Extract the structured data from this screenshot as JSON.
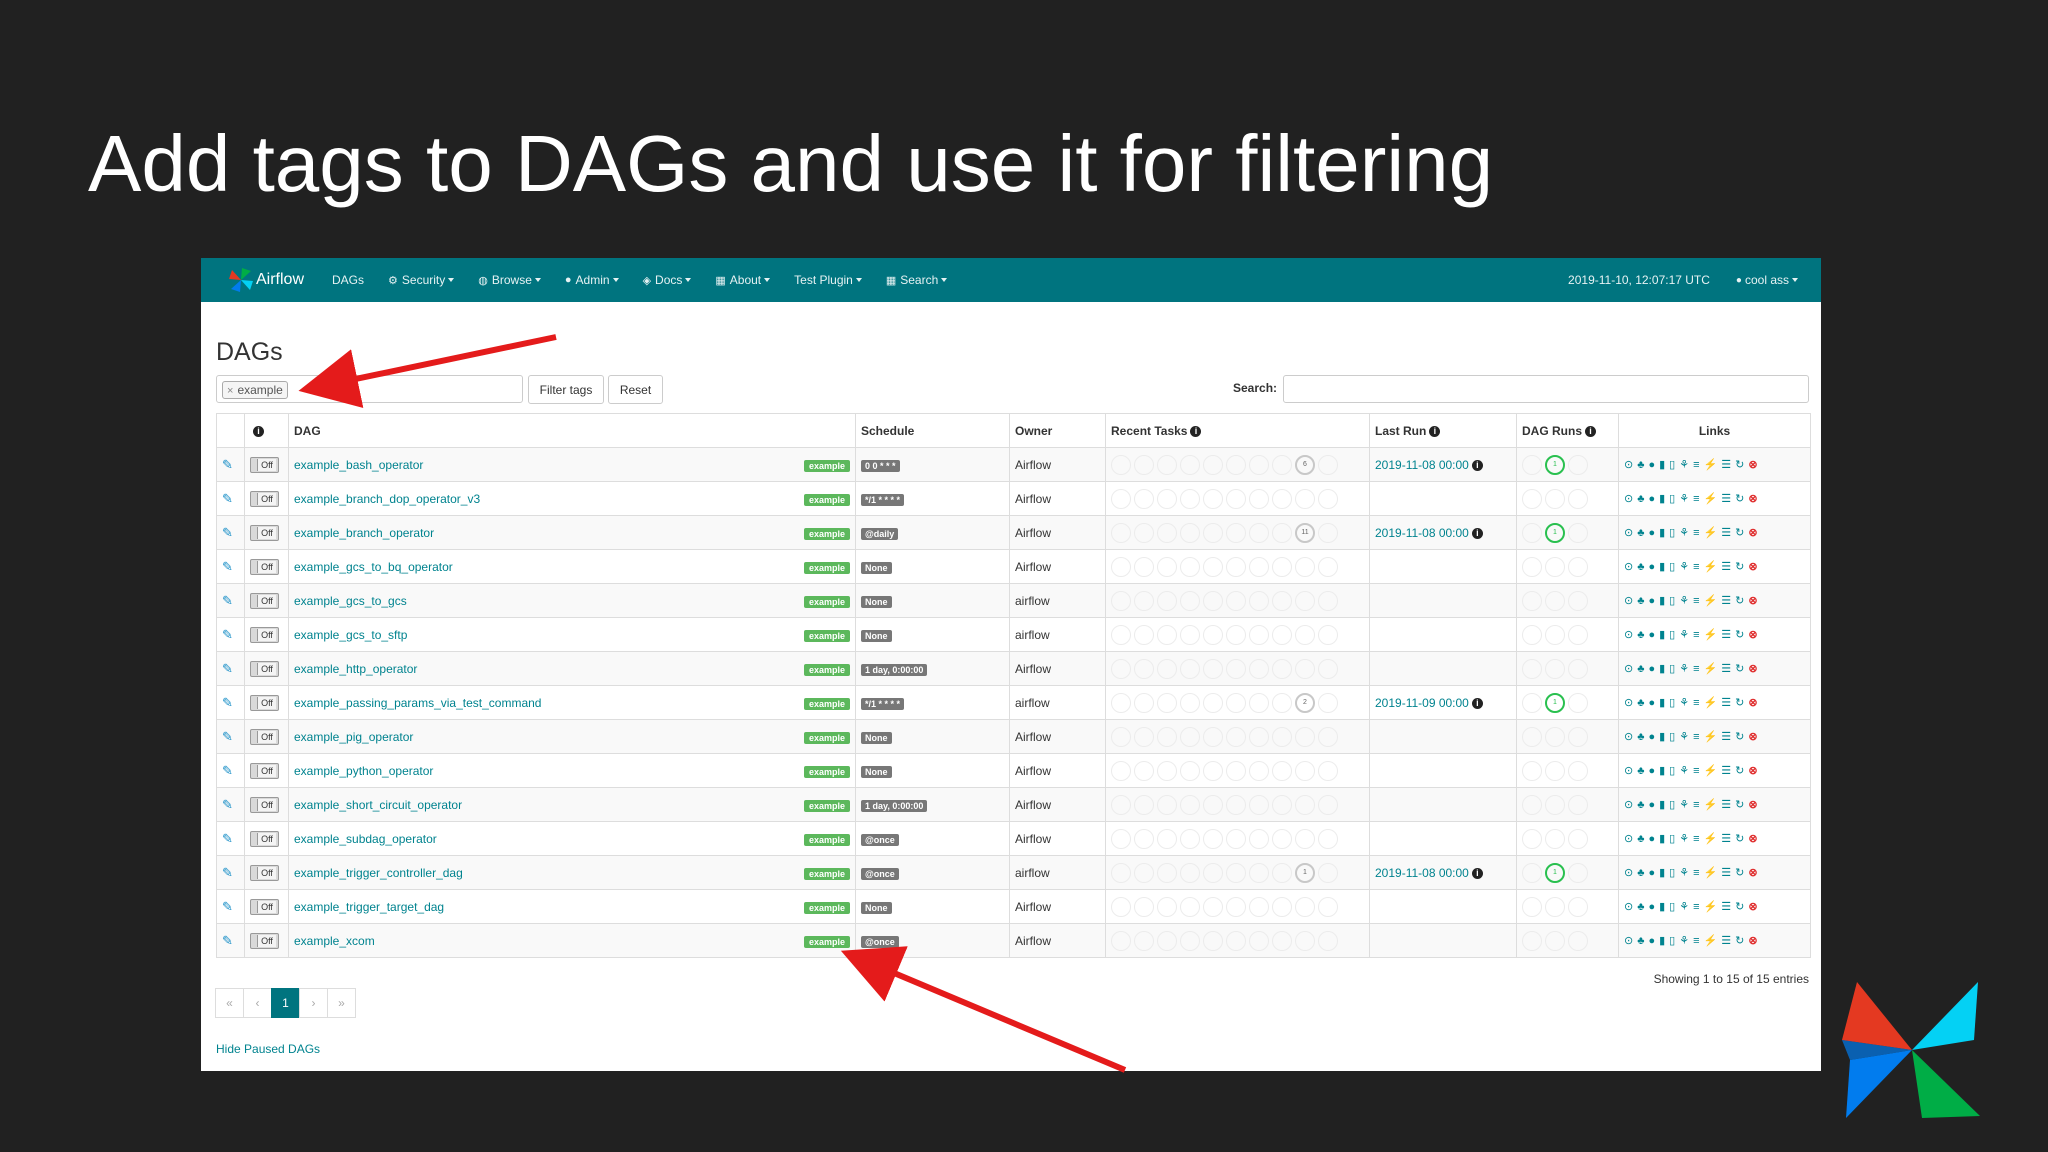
{
  "slide": {
    "title": "Add tags to DAGs and use it for filtering"
  },
  "navbar": {
    "brand": "Airflow",
    "items": [
      {
        "label": "DAGs",
        "icon": ""
      },
      {
        "label": "Security",
        "icon": "gear-icon"
      },
      {
        "label": "Browse",
        "icon": "globe-icon"
      },
      {
        "label": "Admin",
        "icon": "user-icon"
      },
      {
        "label": "Docs",
        "icon": "cube-icon"
      },
      {
        "label": "About",
        "icon": "grid-icon"
      },
      {
        "label": "Test Plugin",
        "icon": ""
      },
      {
        "label": "Search",
        "icon": "grid-icon"
      }
    ],
    "timestamp": "2019-11-10, 12:07:17 UTC",
    "user": "cool ass"
  },
  "page": {
    "title": "DAGs",
    "tag_chip": "example",
    "filter_button": "Filter tags",
    "reset_button": "Reset",
    "search_label": "Search:",
    "entries_info": "Showing 1 to 15 of 15 entries",
    "hide_paused": "Hide Paused DAGs",
    "pagination": [
      "«",
      "‹",
      "1",
      "›",
      "»"
    ]
  },
  "table": {
    "headers": {
      "dag": "DAG",
      "schedule": "Schedule",
      "owner": "Owner",
      "recent_tasks": "Recent Tasks",
      "last_run": "Last Run",
      "dag_runs": "DAG Runs",
      "links": "Links"
    },
    "toggle_label": "Off",
    "rows": [
      {
        "dag": "example_bash_operator",
        "tag": "example",
        "schedule": "0 0 * * *",
        "owner": "Airflow",
        "last_run": "2019-11-08 00:00",
        "task_count": "6",
        "run_count": "1"
      },
      {
        "dag": "example_branch_dop_operator_v3",
        "tag": "example",
        "schedule": "*/1 * * * *",
        "owner": "Airflow",
        "last_run": "",
        "task_count": "",
        "run_count": ""
      },
      {
        "dag": "example_branch_operator",
        "tag": "example",
        "schedule": "@daily",
        "owner": "Airflow",
        "last_run": "2019-11-08 00:00",
        "task_count": "11",
        "run_count": "1"
      },
      {
        "dag": "example_gcs_to_bq_operator",
        "tag": "example",
        "schedule": "None",
        "owner": "Airflow",
        "last_run": "",
        "task_count": "",
        "run_count": ""
      },
      {
        "dag": "example_gcs_to_gcs",
        "tag": "example",
        "schedule": "None",
        "owner": "airflow",
        "last_run": "",
        "task_count": "",
        "run_count": ""
      },
      {
        "dag": "example_gcs_to_sftp",
        "tag": "example",
        "schedule": "None",
        "owner": "airflow",
        "last_run": "",
        "task_count": "",
        "run_count": ""
      },
      {
        "dag": "example_http_operator",
        "tag": "example",
        "schedule": "1 day, 0:00:00",
        "owner": "Airflow",
        "last_run": "",
        "task_count": "",
        "run_count": ""
      },
      {
        "dag": "example_passing_params_via_test_command",
        "tag": "example",
        "schedule": "*/1 * * * *",
        "owner": "airflow",
        "last_run": "2019-11-09 00:00",
        "task_count": "2",
        "run_count": "1"
      },
      {
        "dag": "example_pig_operator",
        "tag": "example",
        "schedule": "None",
        "owner": "Airflow",
        "last_run": "",
        "task_count": "",
        "run_count": ""
      },
      {
        "dag": "example_python_operator",
        "tag": "example",
        "schedule": "None",
        "owner": "Airflow",
        "last_run": "",
        "task_count": "",
        "run_count": ""
      },
      {
        "dag": "example_short_circuit_operator",
        "tag": "example",
        "schedule": "1 day, 0:00:00",
        "owner": "Airflow",
        "last_run": "",
        "task_count": "",
        "run_count": ""
      },
      {
        "dag": "example_subdag_operator",
        "tag": "example",
        "schedule": "@once",
        "owner": "Airflow",
        "last_run": "",
        "task_count": "",
        "run_count": ""
      },
      {
        "dag": "example_trigger_controller_dag",
        "tag": "example",
        "schedule": "@once",
        "owner": "airflow",
        "last_run": "2019-11-08 00:00",
        "task_count": "1",
        "run_count": "1"
      },
      {
        "dag": "example_trigger_target_dag",
        "tag": "example",
        "schedule": "None",
        "owner": "Airflow",
        "last_run": "",
        "task_count": "",
        "run_count": ""
      },
      {
        "dag": "example_xcom",
        "tag": "example",
        "schedule": "@once",
        "owner": "Airflow",
        "last_run": "",
        "task_count": "",
        "run_count": ""
      }
    ]
  },
  "colors": {
    "navbar": "#00747f",
    "link": "#00838f",
    "tag": "#5cb85c",
    "success": "#29c04f",
    "arrow": "#e41b1b"
  }
}
